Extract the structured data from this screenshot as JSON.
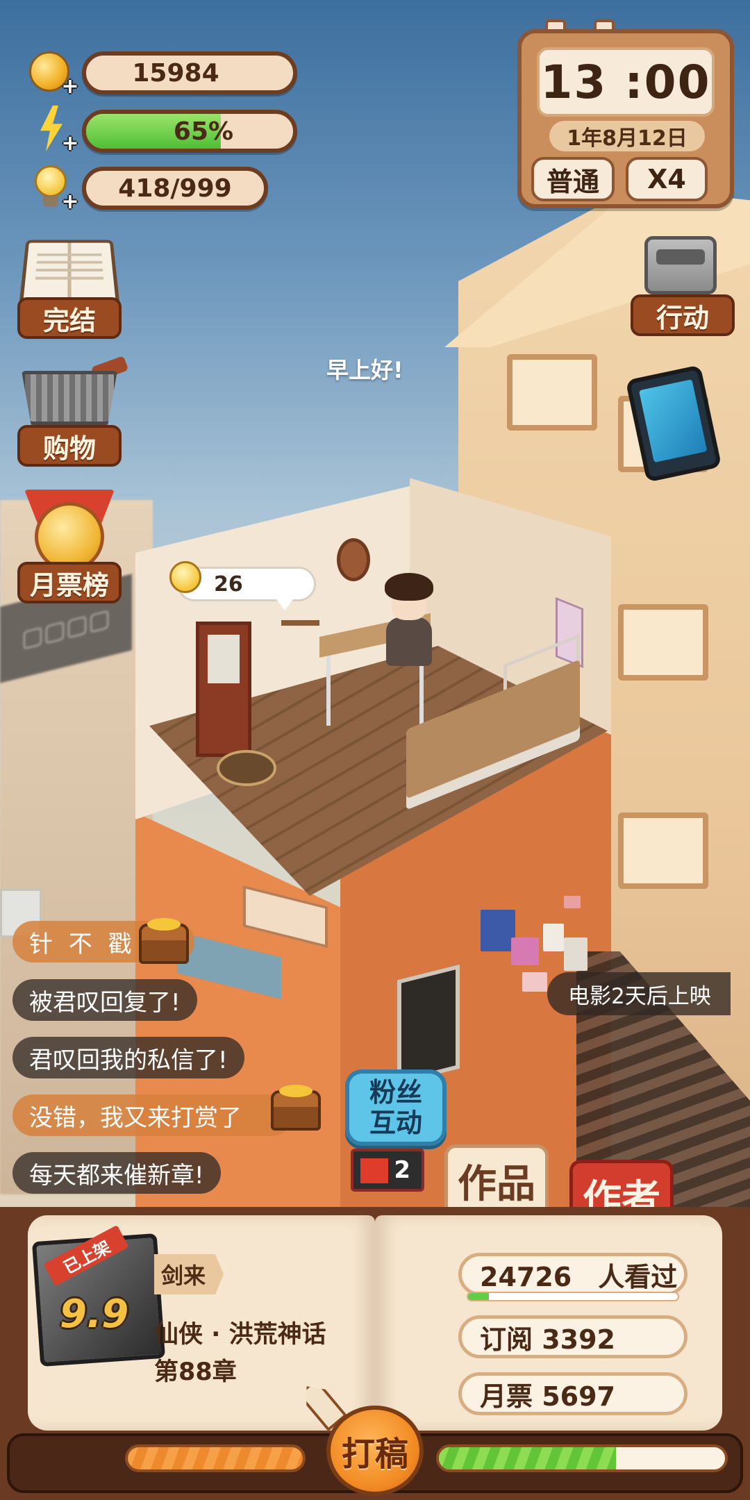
{
  "resources": {
    "coins": "15984",
    "energy_percent": 65,
    "energy_label": "65%",
    "ideas": "418/999"
  },
  "clock": {
    "time": "13 :00",
    "date": "1年8月12日",
    "mode_label": "普通",
    "speed_label": "X4"
  },
  "side_menu": {
    "complete": "完结",
    "shopping": "购物",
    "monthly_rank": "月票榜",
    "action": "行动"
  },
  "scene": {
    "greeting": "早上好!",
    "idea_count": "26",
    "movie_notice": "电影2天后上映"
  },
  "chat": [
    {
      "text": "针 不 戳",
      "style": "gold"
    },
    {
      "text": "被君叹回复了!",
      "style": "dark"
    },
    {
      "text": "君叹回我的私信了!",
      "style": "dark"
    },
    {
      "text": "没错，我又来打赏了",
      "style": "gold"
    },
    {
      "text": "每天都来催新章!",
      "style": "dark"
    }
  ],
  "buttons": {
    "fan_interact": "粉丝互动",
    "fan_badge_count": "2",
    "tab_works": "作品",
    "tab_author": "作者",
    "draft": "打稿"
  },
  "novel": {
    "status_ribbon": "已上架",
    "score": "9.9",
    "title": "剑来",
    "genre": "仙侠 · 洪荒神话",
    "chapter": "第88章"
  },
  "stats": {
    "views": "24726　人看过",
    "views_progress": 0.1,
    "subscriptions": "订阅  3392",
    "monthly_votes": "月票  5697"
  },
  "progress": {
    "left_bar": 1.0,
    "right_bar": 0.62
  },
  "colors": {
    "panel_brown": "#6b3a22",
    "energy_green": "#4fbf38",
    "author_tab_red": "#d23d2e",
    "fan_button_blue": "#5fc5e8"
  },
  "icons": [
    "coin-icon",
    "energy-bolt-icon",
    "idea-bulb-icon",
    "book-icon",
    "basket-icon",
    "medal-icon",
    "action-icon",
    "tablet-icon",
    "treasure-chest-icon",
    "pen-icon"
  ]
}
